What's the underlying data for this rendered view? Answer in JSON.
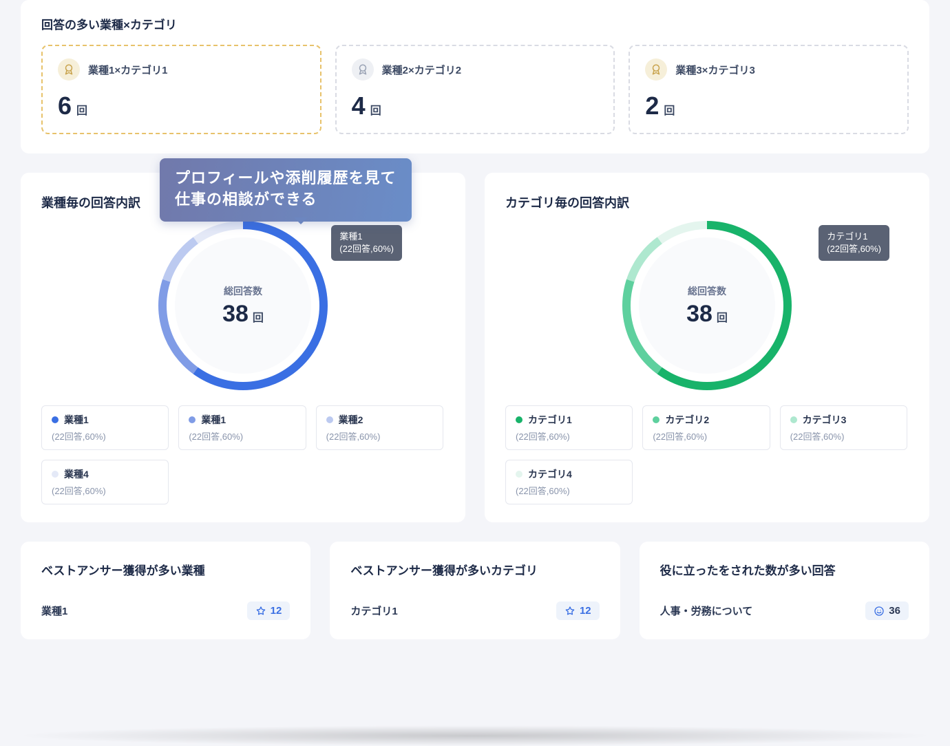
{
  "colors": {
    "blue_series": [
      "#3a6fe3",
      "#809ce6",
      "#bccaf0",
      "#e4e9f7"
    ],
    "green_series": [
      "#18b36a",
      "#5ed09e",
      "#aee8cf",
      "#e4f5ee"
    ],
    "badge_blue": "#3a6fe3"
  },
  "top_card": {
    "title": "回答の多い業種×カテゴリ",
    "ranks": [
      {
        "medal": "gold",
        "label": "業種1×カテゴリ1",
        "value": "6",
        "unit": "回"
      },
      {
        "medal": "silver",
        "label": "業種2×カテゴリ2",
        "value": "4",
        "unit": "回"
      },
      {
        "medal": "bronze",
        "label": "業種3×カテゴリ3",
        "value": "2",
        "unit": "回"
      }
    ]
  },
  "promo": {
    "line1": "プロフィールや添削履歴を見て",
    "line2": "仕事の相談ができる"
  },
  "donuts": {
    "left": {
      "title": "業種毎の回答内訳",
      "center_label": "総回答数",
      "center_value": "38",
      "center_unit": "回",
      "tooltip_name": "業種1",
      "tooltip_detail": "(22回答,60%)",
      "legend": [
        {
          "name": "業種1",
          "detail": "(22回答,60%)",
          "color": "#3a6fe3"
        },
        {
          "name": "業種1",
          "detail": "(22回答,60%)",
          "color": "#809ce6"
        },
        {
          "name": "業種2",
          "detail": "(22回答,60%)",
          "color": "#bccaf0"
        },
        {
          "name": "業種4",
          "detail": "(22回答,60%)",
          "color": "#e4e9f7"
        }
      ]
    },
    "right": {
      "title": "カテゴリ毎の回答内訳",
      "center_label": "総回答数",
      "center_value": "38",
      "center_unit": "回",
      "tooltip_name": "カテゴリ1",
      "tooltip_detail": "(22回答,60%)",
      "legend": [
        {
          "name": "カテゴリ1",
          "detail": "(22回答,60%)",
          "color": "#18b36a"
        },
        {
          "name": "カテゴリ2",
          "detail": "(22回答,60%)",
          "color": "#5ed09e"
        },
        {
          "name": "カテゴリ3",
          "detail": "(22回答,60%)",
          "color": "#aee8cf"
        },
        {
          "name": "カテゴリ4",
          "detail": "(22回答,60%)",
          "color": "#e4f5ee"
        }
      ]
    }
  },
  "stats": [
    {
      "title": "ベストアンサー獲得が多い業種",
      "item": "業種1",
      "icon": "star",
      "count": "12"
    },
    {
      "title": "ベストアンサー獲得が多いカテゴリ",
      "item": "カテゴリ1",
      "icon": "star",
      "count": "12"
    },
    {
      "title": "役に立ったをされた数が多い回答",
      "item": "人事・労務について",
      "icon": "smile",
      "count": "36"
    }
  ],
  "chart_data": [
    {
      "type": "pie",
      "title": "業種毎の回答内訳",
      "center_label": "総回答数",
      "total": 38,
      "unit": "回",
      "series": [
        {
          "name": "業種1",
          "value": 22,
          "percent": 60,
          "color": "#3a6fe3"
        },
        {
          "name": "業種1",
          "value": 22,
          "percent": 60,
          "color": "#809ce6"
        },
        {
          "name": "業種2",
          "value": 22,
          "percent": 60,
          "color": "#bccaf0"
        },
        {
          "name": "業種4",
          "value": 22,
          "percent": 60,
          "color": "#e4e9f7"
        }
      ],
      "segment_angles_deg": [
        216,
        72,
        36,
        36
      ]
    },
    {
      "type": "pie",
      "title": "カテゴリ毎の回答内訳",
      "center_label": "総回答数",
      "total": 38,
      "unit": "回",
      "series": [
        {
          "name": "カテゴリ1",
          "value": 22,
          "percent": 60,
          "color": "#18b36a"
        },
        {
          "name": "カテゴリ2",
          "value": 22,
          "percent": 60,
          "color": "#5ed09e"
        },
        {
          "name": "カテゴリ3",
          "value": 22,
          "percent": 60,
          "color": "#aee8cf"
        },
        {
          "name": "カテゴリ4",
          "value": 22,
          "percent": 60,
          "color": "#e4f5ee"
        }
      ],
      "segment_angles_deg": [
        216,
        72,
        36,
        36
      ]
    }
  ]
}
